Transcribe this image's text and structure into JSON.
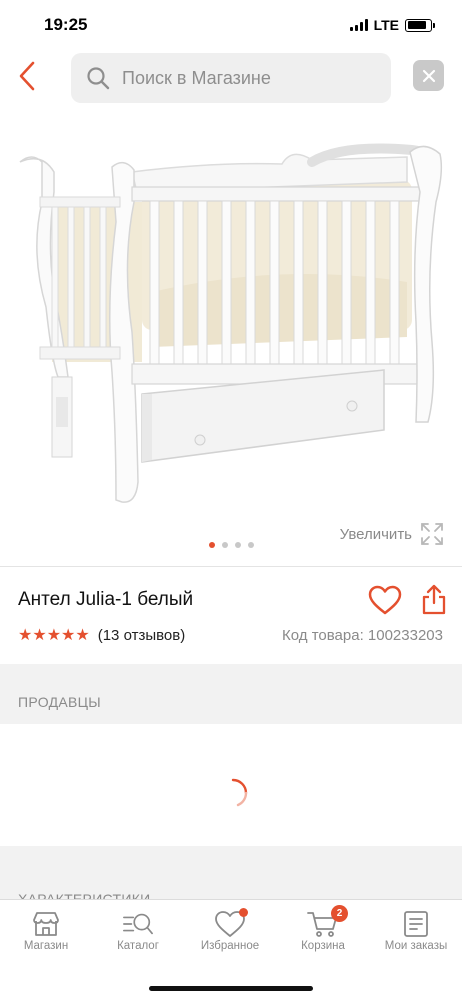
{
  "status_bar": {
    "time": "19:25",
    "network": "LTE"
  },
  "header": {
    "search_placeholder": "Поиск в Магазине",
    "icons": [
      "back-chevron-icon",
      "search-icon",
      "close-icon"
    ]
  },
  "gallery": {
    "zoom_label": "Увеличить",
    "image_count": 4,
    "active_index": 0
  },
  "product": {
    "title": "Антел Julia-1 белый",
    "rating": 5,
    "reviews": "(13 отзывов)",
    "sku": "Код товара: 100233203"
  },
  "sections": {
    "sellers": "ПРОДАВЦЫ",
    "characteristics": "ХАРАКТЕРИСТИКИ"
  },
  "tabs": [
    {
      "label": "Магазин",
      "icon": "store-icon"
    },
    {
      "label": "Каталог",
      "icon": "catalog-search-icon"
    },
    {
      "label": "Избранное",
      "icon": "heart-icon"
    },
    {
      "label": "Корзина",
      "icon": "cart-icon",
      "badge": "2"
    },
    {
      "label": "Мои заказы",
      "icon": "orders-icon"
    }
  ],
  "colors": {
    "accent": "#e4502f",
    "muted_text": "#8a8a8a",
    "section_bg": "#f2f2f2",
    "search_bg": "#efefef"
  }
}
